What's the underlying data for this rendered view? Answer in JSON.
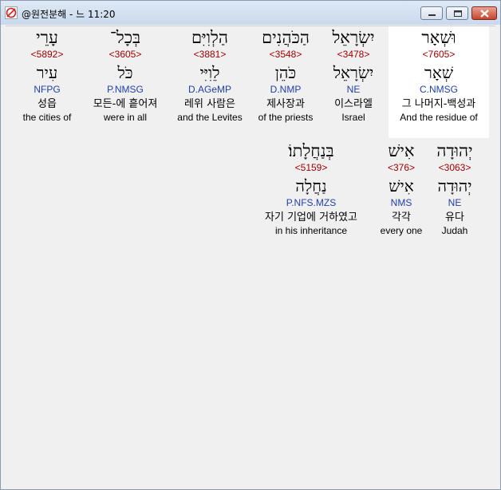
{
  "window": {
    "title": "@원전분해 - 느 11:20"
  },
  "words": [
    {
      "hebrew": "וּשְׁאָר",
      "strong": "<7605>",
      "lemma": "שְׁאָר",
      "morph": "C.NMSG",
      "korean": "그 나머지-백성과",
      "english": "And the residue of",
      "selected": true
    },
    {
      "hebrew": "יִשְׂרָאֵל",
      "strong": "<3478>",
      "lemma": "יִשְׂרָאֵל",
      "morph": "NE",
      "korean": "이스라엘",
      "english": "Israel",
      "selected": false
    },
    {
      "hebrew": "הַכֹּהֲנִים",
      "strong": "<3548>",
      "lemma": "כֹּהֵן",
      "morph": "D.NMP",
      "korean": "제사장과",
      "english": "of the priests",
      "selected": false
    },
    {
      "hebrew": "הַלְוִיִּם",
      "strong": "<3881>",
      "lemma": "לֵוִיִּי",
      "morph": "D.AGeMP",
      "korean": "레위 사람은",
      "english": "and the Levites",
      "selected": false
    },
    {
      "hebrew": "בְּכָל־",
      "strong": "<3605>",
      "lemma": "כֹּל",
      "morph": "P.NMSG",
      "korean": "모든-에 흩어져",
      "english": "were in all",
      "selected": false
    },
    {
      "hebrew": "עָרֵי",
      "strong": "<5892>",
      "lemma": "עִיר",
      "morph": "NFPG",
      "korean": "성읍",
      "english": "the cities of",
      "selected": false
    },
    {
      "hebrew": "יְהוּדָה",
      "strong": "<3063>",
      "lemma": "יְהוּדָה",
      "morph": "NE",
      "korean": "유다",
      "english": "Judah",
      "selected": false
    },
    {
      "hebrew": "אִישׁ",
      "strong": "<376>",
      "lemma": "אִישׁ",
      "morph": "NMS",
      "korean": "각각",
      "english": "every one",
      "selected": false
    },
    {
      "hebrew": "בְּנַחֲלָתוֹ׃",
      "strong": "<5159>",
      "lemma": "נַחֲלָה",
      "morph": "P.NFS.MZS",
      "korean": "자기 기업에 거하였고",
      "english": "in his inheritance",
      "selected": false
    }
  ]
}
